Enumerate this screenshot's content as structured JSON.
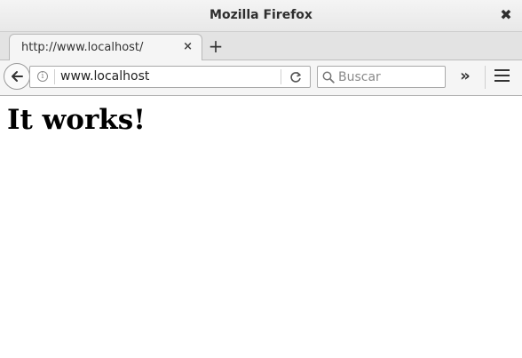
{
  "window": {
    "title": "Mozilla Firefox",
    "close_symbol": "✖"
  },
  "tabs": [
    {
      "label": "http://www.localhost/",
      "close_symbol": "×"
    }
  ],
  "new_tab_symbol": "+",
  "navbar": {
    "url": "www.localhost",
    "search_placeholder": "Buscar",
    "overflow_symbol": "»"
  },
  "page": {
    "heading": "It works!"
  }
}
